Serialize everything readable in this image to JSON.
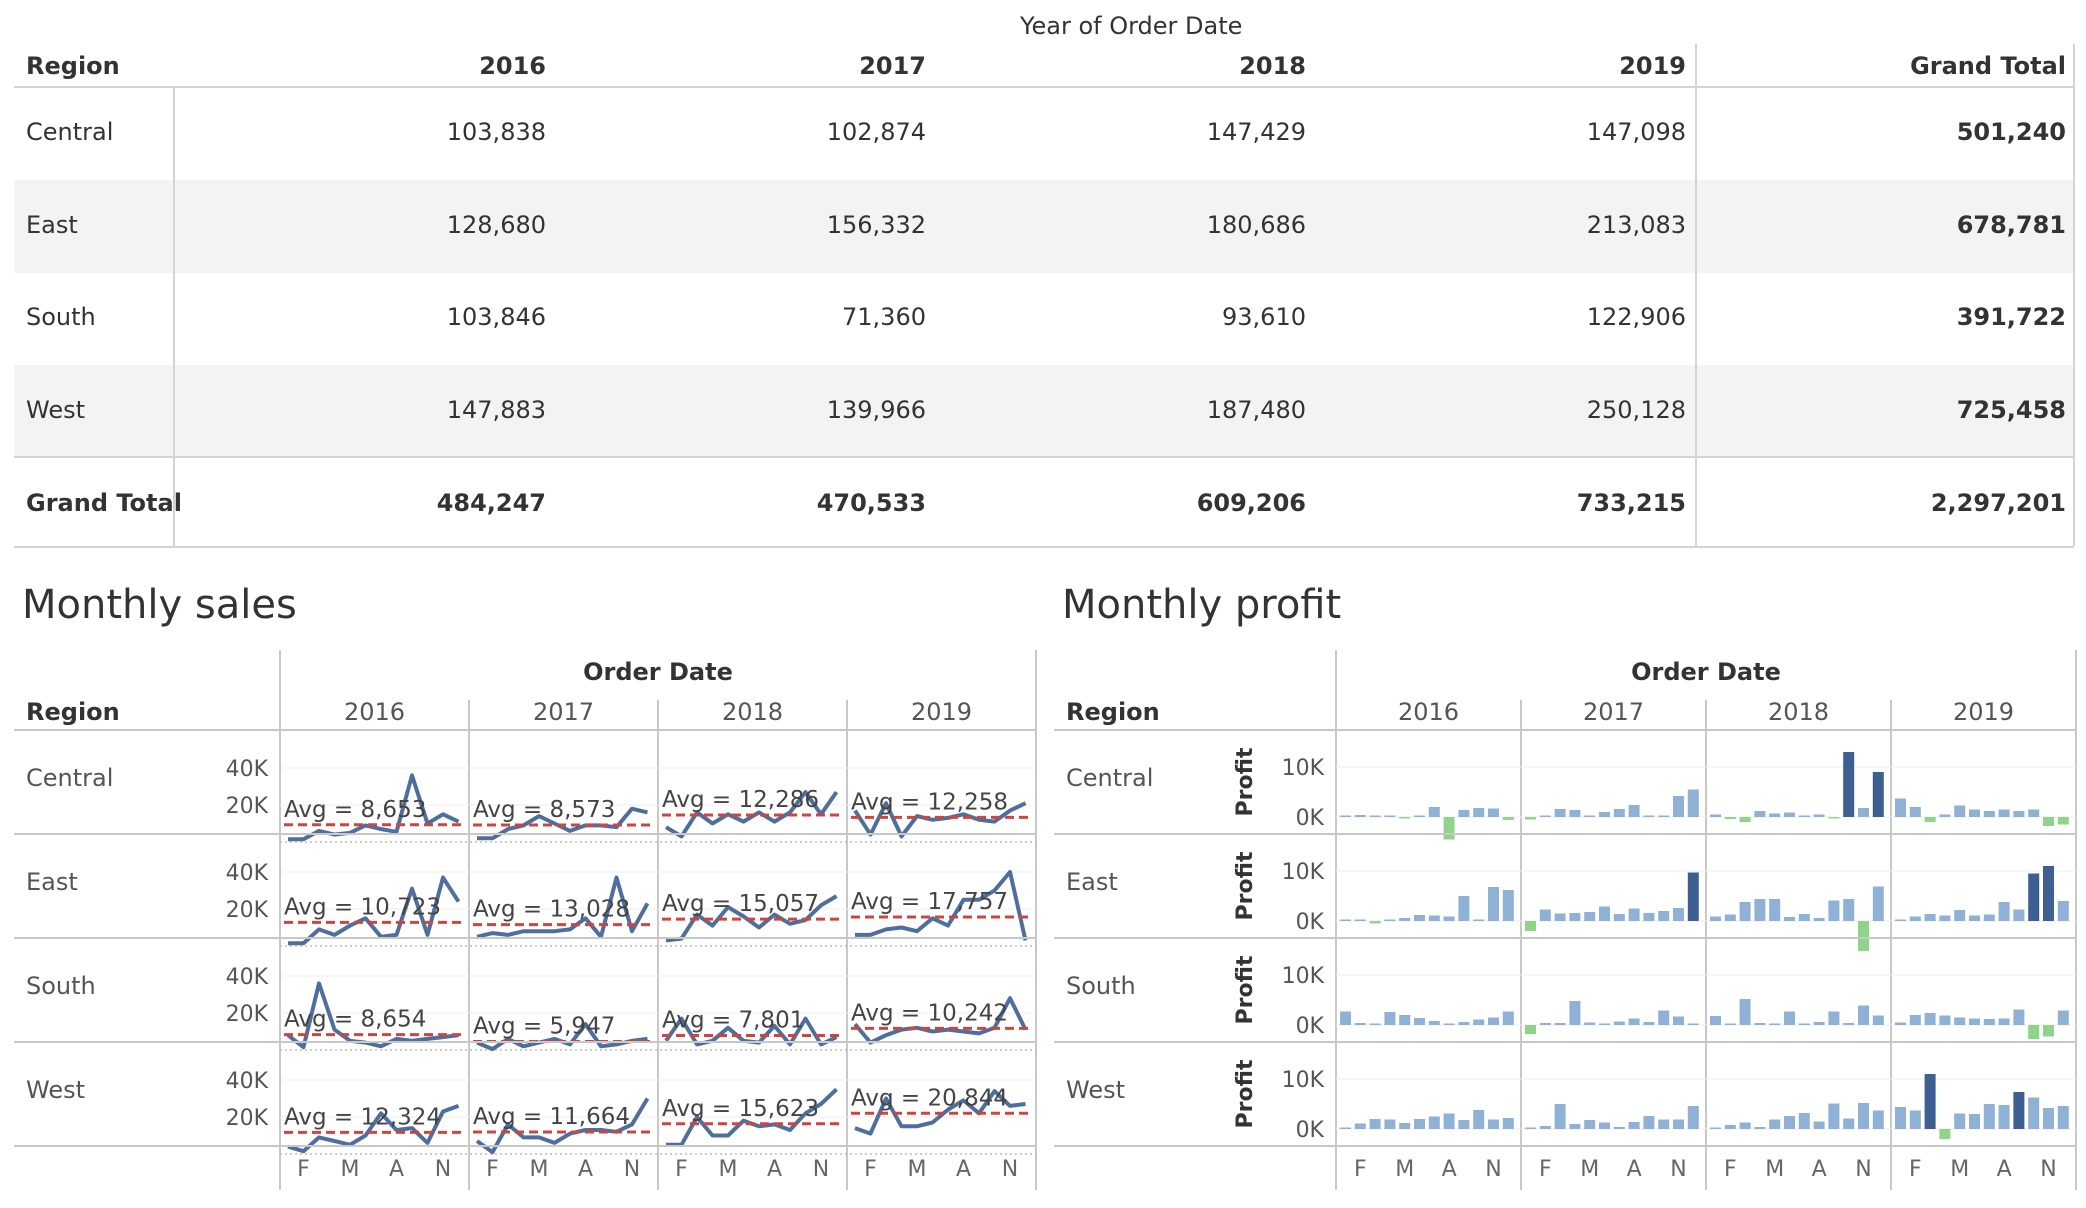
{
  "crosstab": {
    "super_header": "Year of Order Date",
    "row_header": "Region",
    "columns": [
      "2016",
      "2017",
      "2018",
      "2019",
      "Grand Total"
    ],
    "rows": [
      {
        "label": "Central",
        "values": [
          "103,838",
          "102,874",
          "147,429",
          "147,098",
          "501,240"
        ]
      },
      {
        "label": "East",
        "values": [
          "128,680",
          "156,332",
          "180,686",
          "213,083",
          "678,781"
        ]
      },
      {
        "label": "South",
        "values": [
          "103,846",
          "71,360",
          "93,610",
          "122,906",
          "391,722"
        ]
      },
      {
        "label": "West",
        "values": [
          "147,883",
          "139,966",
          "187,480",
          "250,128",
          "725,458"
        ]
      },
      {
        "label": "Grand Total",
        "values": [
          "484,247",
          "470,533",
          "609,206",
          "733,215",
          "2,297,201"
        ]
      }
    ]
  },
  "sales_title": "Monthly sales",
  "profit_title": "Monthly profit",
  "colors": {
    "line": "#4e6f9d",
    "line_light": "#a9bbd3",
    "avg_line": "#d0443f",
    "bar_blue": "#8fb1d6",
    "bar_dark": "#3d5f91",
    "bar_green": "#8fd48a",
    "grid": "#d9d9d9",
    "band": "#f3f3f3"
  },
  "chart_data": [
    {
      "type": "line",
      "title": "Monthly sales",
      "super_header": "Order Date",
      "row_header": "Region",
      "years": [
        "2016",
        "2017",
        "2018",
        "2019"
      ],
      "regions": [
        "Central",
        "East",
        "South",
        "West"
      ],
      "x_tick_labels": [
        "F",
        "M",
        "A",
        "N"
      ],
      "y_ticks": [
        "40K",
        "20K"
      ],
      "ylim": [
        0,
        45000
      ],
      "reference_line": "average per region and year (dashed)",
      "series": [
        {
          "region": "Central",
          "averages": [
            "Avg = 8,653",
            "Avg = 8,573",
            "Avg = 12,286",
            "Avg = 12,258"
          ],
          "values": [
            [
              1500,
              1500,
              6000,
              4000,
              5000,
              9000,
              7000,
              5500,
              36000,
              10000,
              15000,
              11000
            ],
            [
              2000,
              2000,
              7000,
              9000,
              14000,
              10000,
              6000,
              9000,
              9000,
              8000,
              18000,
              16000
            ],
            [
              8000,
              3000,
              16000,
              10000,
              15000,
              11000,
              16000,
              11000,
              16000,
              27000,
              15000,
              27000
            ],
            [
              17000,
              4000,
              21000,
              3000,
              14000,
              12000,
              13000,
              15000,
              12000,
              11000,
              17000,
              21000
            ]
          ]
        },
        {
          "region": "East",
          "averages": [
            "Avg = 10,723",
            "Avg = 13,028",
            "Avg = 15,057",
            "Avg = 17,757"
          ],
          "values": [
            [
              1500,
              1500,
              9000,
              6000,
              11000,
              15000,
              5000,
              6000,
              31000,
              6000,
              37000,
              24000
            ],
            [
              5000,
              7000,
              6000,
              8000,
              8000,
              8000,
              9000,
              15000,
              5000,
              37000,
              8000,
              23000
            ],
            [
              3000,
              4000,
              17000,
              11000,
              21000,
              16000,
              10000,
              17000,
              12000,
              14000,
              22000,
              27000
            ],
            [
              6000,
              6000,
              9000,
              10000,
              8000,
              15000,
              11000,
              25000,
              25000,
              30000,
              40000,
              3000
            ]
          ]
        },
        {
          "region": "South",
          "averages": [
            "Avg = 8,654",
            "Avg = 5,947",
            "Avg = 7,801",
            "Avg = 10,242"
          ],
          "values": [
            [
              8000,
              1500,
              36000,
              11000,
              5000,
              4000,
              2000,
              6000,
              5000,
              6000,
              7000,
              8000
            ],
            [
              4000,
              500,
              6000,
              2000,
              4000,
              6000,
              3000,
              14000,
              2000,
              3000,
              5000,
              6000
            ],
            [
              5000,
              17000,
              3000,
              5000,
              12000,
              5000,
              4000,
              13000,
              3000,
              17000,
              3000,
              7000
            ],
            [
              14000,
              4000,
              8000,
              11000,
              12000,
              10000,
              11000,
              10000,
              9000,
              12000,
              28000,
              11000
            ]
          ]
        },
        {
          "region": "West",
          "averages": [
            "Avg = 12,324",
            "Avg = 11,664",
            "Avg = 15,623",
            "Avg = 20,844"
          ],
          "values": [
            [
              4000,
              1500,
              9000,
              7000,
              5000,
              10000,
              22000,
              13000,
              14000,
              6000,
              23000,
              26000
            ],
            [
              7000,
              1000,
              16000,
              9000,
              9000,
              6000,
              11000,
              13000,
              13000,
              12000,
              16000,
              30000
            ],
            [
              5000,
              5000,
              20000,
              10000,
              10000,
              18000,
              15000,
              16000,
              13000,
              22000,
              27000,
              35000
            ],
            [
              14000,
              11000,
              30000,
              15000,
              15000,
              17000,
              24000,
              29000,
              22000,
              34000,
              26000,
              27000
            ]
          ]
        }
      ]
    },
    {
      "type": "bar",
      "title": "Monthly profit",
      "super_header": "Order Date",
      "row_header": "Region",
      "years": [
        "2016",
        "2017",
        "2018",
        "2019"
      ],
      "regions": [
        "Central",
        "East",
        "South",
        "West"
      ],
      "x_tick_labels": [
        "F",
        "M",
        "A",
        "N"
      ],
      "ylabel": "Profit",
      "y_ticks": [
        "10K",
        "0K"
      ],
      "ylim": [
        -5000,
        13000
      ],
      "series": [
        {
          "region": "Central",
          "values": [
            [
              200,
              400,
              200,
              300,
              -300,
              200,
              2000,
              -4500,
              1400,
              1800,
              1700,
              -600
            ],
            [
              -500,
              300,
              1600,
              1400,
              200,
              1000,
              1600,
              2400,
              200,
              300,
              4200,
              5500
            ],
            [
              500,
              -400,
              -1000,
              1200,
              700,
              900,
              200,
              500,
              -200,
              13000,
              1800,
              9000
            ],
            [
              3700,
              2000,
              -1000,
              500,
              2300,
              1500,
              1200,
              1500,
              1200,
              1500,
              -1800,
              -1500
            ]
          ]
        },
        {
          "region": "East",
          "values": [
            [
              200,
              300,
              -500,
              300,
              600,
              1200,
              1100,
              900,
              5000,
              200,
              6800,
              6200
            ],
            [
              -2000,
              2300,
              1500,
              1600,
              1800,
              2900,
              1400,
              2500,
              1600,
              2000,
              2600,
              9700
            ],
            [
              900,
              1300,
              3800,
              4400,
              4400,
              800,
              1400,
              600,
              4100,
              4400,
              -6000,
              6900
            ],
            [
              200,
              900,
              1400,
              1100,
              2200,
              1100,
              1300,
              3800,
              2300,
              9500,
              11000,
              4000
            ]
          ]
        },
        {
          "region": "South",
          "values": [
            [
              2700,
              400,
              200,
              2600,
              2000,
              1400,
              800,
              200,
              600,
              1100,
              1500,
              2700
            ],
            [
              -1800,
              400,
              400,
              4800,
              500,
              200,
              700,
              1300,
              600,
              2900,
              1700,
              200
            ],
            [
              1800,
              200,
              5200,
              400,
              300,
              2700,
              200,
              600,
              2700,
              400,
              3900,
              1900
            ],
            [
              500,
              2000,
              2400,
              1900,
              1500,
              1300,
              1200,
              1300,
              3100,
              -2800,
              -2300,
              2900
            ]
          ]
        },
        {
          "region": "West",
          "values": [
            [
              200,
              1100,
              2000,
              1900,
              1200,
              2000,
              2500,
              3100,
              1800,
              3800,
              1900,
              2200
            ],
            [
              200,
              600,
              5000,
              1000,
              1800,
              1300,
              400,
              1400,
              2600,
              1900,
              1900,
              4600
            ],
            [
              300,
              800,
              1300,
              400,
              1900,
              2600,
              3200,
              1500,
              5100,
              2100,
              5200,
              3700
            ],
            [
              4400,
              3700,
              11000,
              -2000,
              3100,
              3000,
              5000,
              4800,
              7400,
              6300,
              4200,
              4600
            ]
          ]
        }
      ]
    }
  ]
}
